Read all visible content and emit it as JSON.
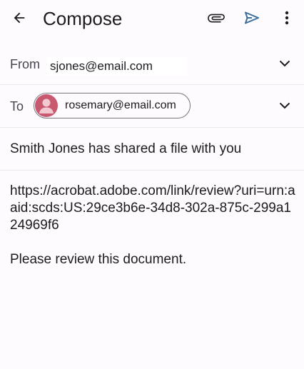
{
  "appbar": {
    "title": "Compose",
    "icons": {
      "back": "arrow-back-icon",
      "attach": "paperclip-icon",
      "send": "send-icon",
      "more": "more-vert-icon"
    },
    "accent_color": "#3c6e9e"
  },
  "from": {
    "label": "From",
    "value": "sjones@email.com"
  },
  "to": {
    "label": "To",
    "recipient": "rosemary@email.com",
    "avatar_color": "#c9596f"
  },
  "subject": "Smith Jones has shared a file with you",
  "body": {
    "lines": [
      "https://acrobat.adobe.com/link/review?uri=urn:aaid:scds:US:29ce3b6e-34d8-302a-875c-299a124969f6",
      "Please review this document."
    ]
  }
}
